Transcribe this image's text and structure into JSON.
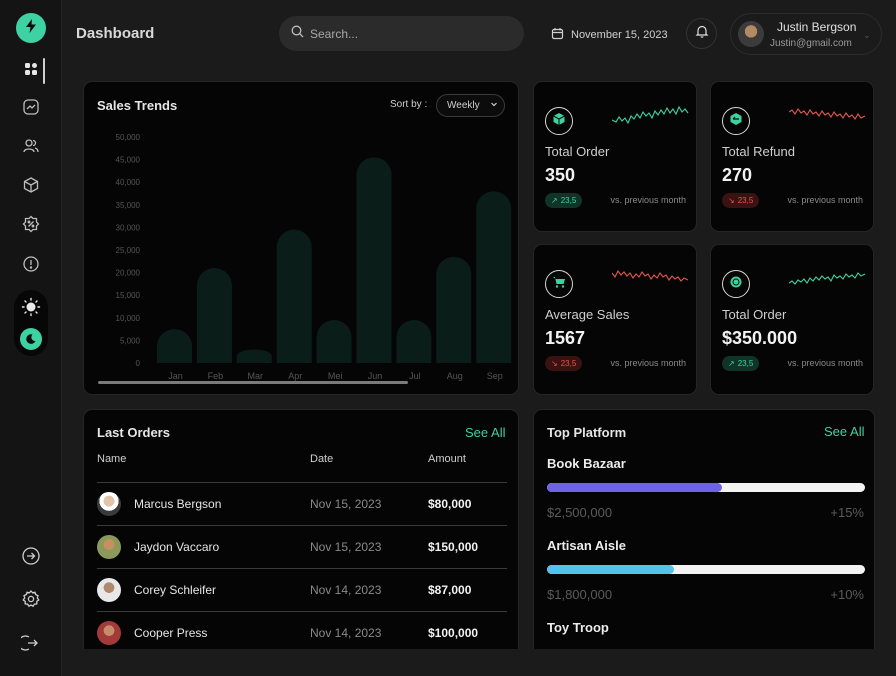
{
  "header": {
    "title": "Dashboard",
    "search_placeholder": "Search...",
    "date": "November 15, 2023",
    "user_name": "Justin Bergson",
    "user_email": "Justin@gmail.com"
  },
  "sidebar": {
    "items": [
      {
        "icon": "dashboard-grid-icon",
        "active": true
      },
      {
        "icon": "trend-chart-icon"
      },
      {
        "icon": "users-icon"
      },
      {
        "icon": "box-icon"
      },
      {
        "icon": "discount-badge-icon"
      },
      {
        "icon": "info-icon"
      }
    ],
    "bottom": [
      "arrow-right-circle-icon",
      "settings-icon",
      "logout-icon"
    ]
  },
  "sales": {
    "title": "Sales Trends",
    "sort_label": "Sort by :",
    "sort_value": "Weekly"
  },
  "chart_data": {
    "type": "bar",
    "title": "Sales Trends",
    "categories": [
      "Jan",
      "Feb",
      "Mar",
      "Apr",
      "Mei",
      "Jun",
      "Jul",
      "Aug",
      "Sep"
    ],
    "values": [
      7500,
      21000,
      3000,
      29500,
      9500,
      45500,
      9500,
      23500,
      38000
    ],
    "ylim": [
      0,
      50000
    ],
    "yticks": [
      "50,000",
      "45,000",
      "40,000",
      "35,000",
      "30,000",
      "25,000",
      "20,000",
      "15,000",
      "10,000",
      "5,000",
      "0"
    ],
    "bar_color": "#0b1d18",
    "grid": false
  },
  "stats": [
    {
      "label": "Total Order",
      "value": "350",
      "change": "23,5",
      "trend": "up",
      "vs": "vs. previous month",
      "icon": "cube-icon"
    },
    {
      "label": "Total Refund",
      "value": "270",
      "change": "23,5",
      "trend": "down",
      "vs": "vs. previous month",
      "icon": "refund-box-icon"
    },
    {
      "label": "Average Sales",
      "value": "1567",
      "change": "23,5",
      "trend": "down",
      "vs": "vs. previous month",
      "icon": "cart-icon"
    },
    {
      "label": "Total Order",
      "value": "$350.000",
      "change": "23,5",
      "trend": "up",
      "vs": "vs. previous month",
      "icon": "coins-icon"
    }
  ],
  "orders": {
    "title": "Last Orders",
    "see_all": "See All",
    "columns": [
      "Name",
      "Date",
      "Amount"
    ],
    "rows": [
      {
        "name": "Marcus Bergson",
        "date": "Nov 15, 2023",
        "amount": "$80,000"
      },
      {
        "name": "Jaydon Vaccaro",
        "date": "Nov 15, 2023",
        "amount": "$150,000"
      },
      {
        "name": "Corey Schleifer",
        "date": "Nov 14, 2023",
        "amount": "$87,000"
      },
      {
        "name": "Cooper Press",
        "date": "Nov 14, 2023",
        "amount": "$100,000"
      }
    ]
  },
  "platform": {
    "title": "Top Platform",
    "see_all": "See All",
    "items": [
      {
        "name": "Book Bazaar",
        "amount": "$2,500,000",
        "pct": "+15%",
        "progress": 0.55,
        "color": "#6e62e5"
      },
      {
        "name": "Artisan Aisle",
        "amount": "$1,800,000",
        "pct": "+10%",
        "progress": 0.4,
        "color": "#54c3eb"
      },
      {
        "name": "Toy Troop",
        "amount": "",
        "pct": "",
        "progress": 0,
        "color": "#e2574c"
      }
    ]
  },
  "colors": {
    "accent": "#3ed1a2",
    "up": "#3ed1a2",
    "down": "#e2574c"
  }
}
